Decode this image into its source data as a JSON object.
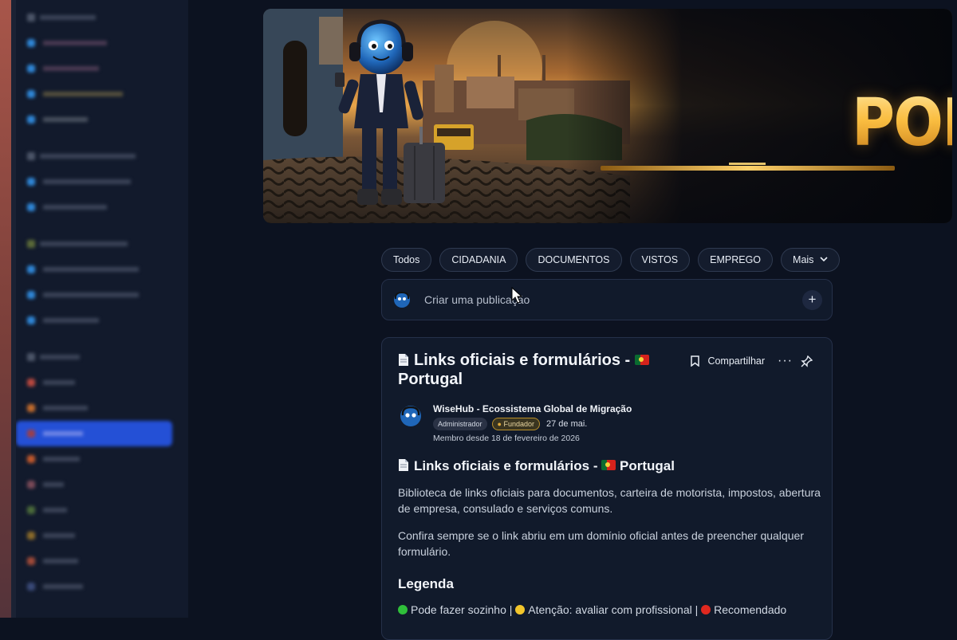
{
  "sidebar": {
    "blurred": true,
    "active_item_color": "#2450d6"
  },
  "banner": {
    "title": "PORTUGAL"
  },
  "tabs": [
    {
      "label": "Todos"
    },
    {
      "label": "CIDADANIA"
    },
    {
      "label": "DOCUMENTOS"
    },
    {
      "label": "VISTOS"
    },
    {
      "label": "EMPREGO"
    },
    {
      "label": "Mais",
      "icon": "chevron-down-icon"
    }
  ],
  "composer": {
    "placeholder": "Criar uma publicação",
    "plus": "+"
  },
  "post": {
    "title_text": "Links oficiais e formulários -",
    "title_suffix": "Portugal",
    "actions": {
      "share": "Compartilhar",
      "more": "···"
    },
    "author": {
      "name": "WiseHub - Ecossistema Global de Migração",
      "badge_admin": "Administrador",
      "badge_founder": "Fundador",
      "date": "27 de mai.",
      "member_since": "Membro desde 18 de fevereiro de 2026"
    },
    "heading": "Links oficiais e formulários -",
    "heading_suffix": "Portugal",
    "paragraph1": "Biblioteca de links oficiais para documentos, carteira de motorista, impostos, abertura de empresa, consulado e serviços comuns.",
    "paragraph2": "Confira sempre se o link abriu em um domínio oficial antes de preencher qualquer formulário.",
    "legend_title": "Legenda",
    "legend": {
      "green": "Pode fazer sozinho",
      "sep": "|",
      "yellow": "Atenção: avaliar com profissional",
      "red": "Recomendado"
    }
  },
  "colors": {
    "background": "#0c1220",
    "card": "#111a2b",
    "gold": "#f3b43b",
    "dot_green": "#2fbf3a",
    "dot_yellow": "#f2c52b",
    "dot_red": "#e0281f"
  }
}
